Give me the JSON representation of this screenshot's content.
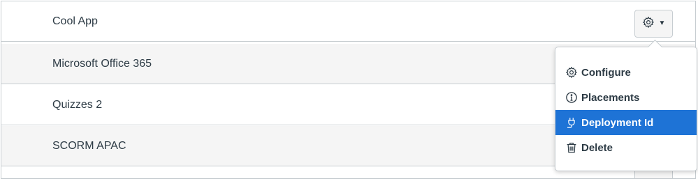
{
  "apps": [
    {
      "name": "Cool App"
    },
    {
      "name": "Microsoft Office 365"
    },
    {
      "name": "Quizzes 2"
    },
    {
      "name": "SCORM APAC"
    }
  ],
  "settings_button": {
    "icon": "gear-icon",
    "caret": "▼"
  },
  "menu": {
    "items": [
      {
        "label": "Configure",
        "icon": "gear-icon"
      },
      {
        "label": "Placements",
        "icon": "info-icon"
      },
      {
        "label": "Deployment Id",
        "icon": "plug-icon",
        "active": true
      },
      {
        "label": "Delete",
        "icon": "trash-icon"
      }
    ]
  },
  "colors": {
    "text": "#2d3b45",
    "active_bg": "#1e73d6",
    "active_text": "#ffffff",
    "alt_row_bg": "#f5f5f5",
    "border": "#c7cdd1"
  }
}
